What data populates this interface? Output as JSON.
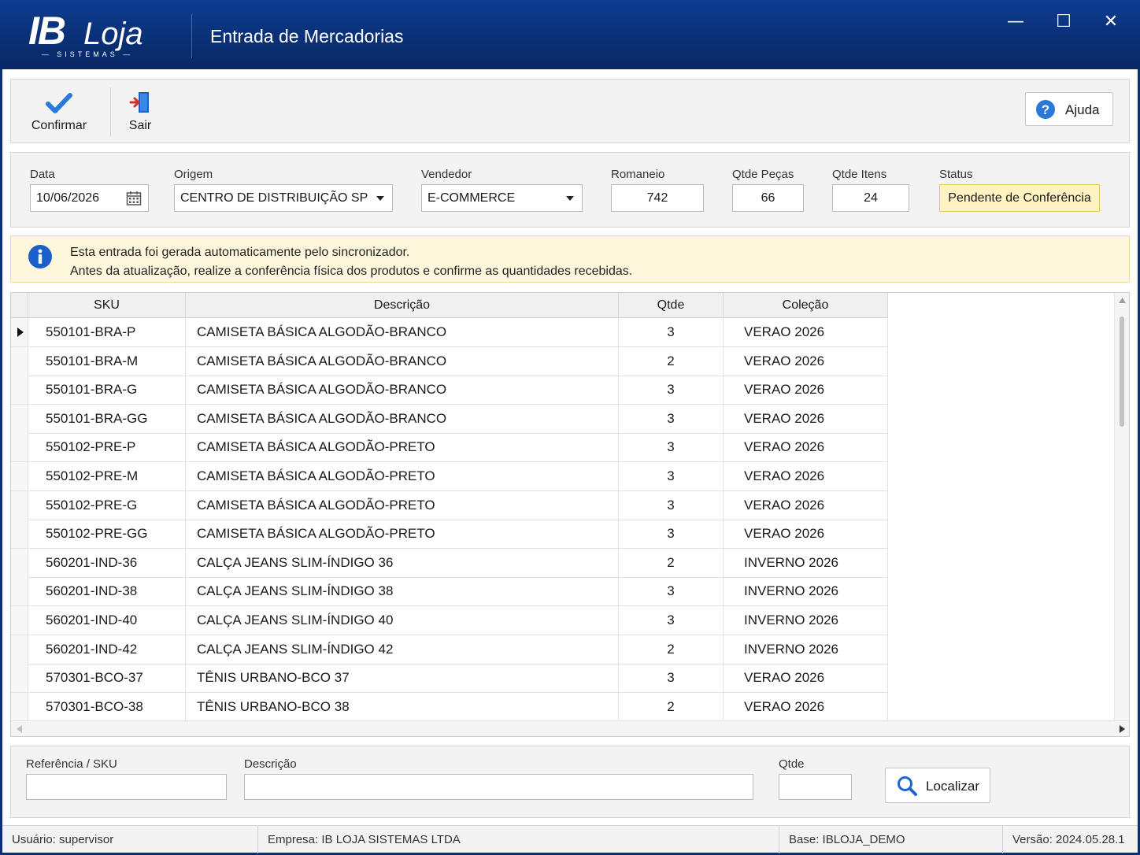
{
  "window": {
    "logo_main": "IB",
    "logo_secondary": "Loja",
    "logo_sub": "— SISTEMAS —",
    "title": "Entrada de Mercadorias",
    "minimize": "—",
    "maximize": "☐",
    "close": "✕"
  },
  "toolbar": {
    "confirm_label": "Confirmar",
    "exit_label": "Sair",
    "help_label": "Ajuda"
  },
  "form": {
    "data_label": "Data",
    "data_value": "10/06/2026",
    "origem_label": "Origem",
    "origem_value": "CENTRO DE DISTRIBUIÇÃO SP",
    "vendedor_label": "Vendedor",
    "vendedor_value": "E-COMMERCE",
    "romaneio_label": "Romaneio",
    "romaneio_value": "742",
    "qtde_pecas_label": "Qtde Peças",
    "qtde_pecas_value": "66",
    "qtde_itens_label": "Qtde Itens",
    "qtde_itens_value": "24",
    "status_label": "Status",
    "status_value": "Pendente de Conferência"
  },
  "info": {
    "line1": "Esta entrada foi gerada automaticamente pelo sincronizador.",
    "line2": "Antes da atualização, realize a conferência física dos produtos e confirme as quantidades recebidas."
  },
  "grid": {
    "headers": [
      "SKU",
      "Descrição",
      "Qtde",
      "Coleção"
    ],
    "rows": [
      [
        "550101-BRA-P",
        "CAMISETA BÁSICA ALGODÃO-BRANCO",
        "3",
        "VERAO 2026"
      ],
      [
        "550101-BRA-M",
        "CAMISETA BÁSICA ALGODÃO-BRANCO",
        "2",
        "VERAO 2026"
      ],
      [
        "550101-BRA-G",
        "CAMISETA BÁSICA ALGODÃO-BRANCO",
        "3",
        "VERAO 2026"
      ],
      [
        "550101-BRA-GG",
        "CAMISETA BÁSICA ALGODÃO-BRANCO",
        "3",
        "VERAO 2026"
      ],
      [
        "550102-PRE-P",
        "CAMISETA BÁSICA ALGODÃO-PRETO",
        "3",
        "VERAO 2026"
      ],
      [
        "550102-PRE-M",
        "CAMISETA BÁSICA ALGODÃO-PRETO",
        "3",
        "VERAO 2026"
      ],
      [
        "550102-PRE-G",
        "CAMISETA BÁSICA ALGODÃO-PRETO",
        "3",
        "VERAO 2026"
      ],
      [
        "550102-PRE-GG",
        "CAMISETA BÁSICA ALGODÃO-PRETO",
        "3",
        "VERAO 2026"
      ],
      [
        "560201-IND-36",
        "CALÇA JEANS SLIM-ÍNDIGO 36",
        "2",
        "INVERNO 2026"
      ],
      [
        "560201-IND-38",
        "CALÇA JEANS SLIM-ÍNDIGO 38",
        "3",
        "INVERNO 2026"
      ],
      [
        "560201-IND-40",
        "CALÇA JEANS SLIM-ÍNDIGO 40",
        "3",
        "INVERNO 2026"
      ],
      [
        "560201-IND-42",
        "CALÇA JEANS SLIM-ÍNDIGO 42",
        "2",
        "INVERNO 2026"
      ],
      [
        "570301-BCO-37",
        "TÊNIS URBANO-BCO 37",
        "3",
        "VERAO 2026"
      ],
      [
        "570301-BCO-38",
        "TÊNIS URBANO-BCO 38",
        "2",
        "VERAO 2026"
      ]
    ]
  },
  "search": {
    "ref_label": "Referência / SKU",
    "ref_value": "",
    "desc_label": "Descrição",
    "desc_value": "",
    "qtde_label": "Qtde",
    "qtde_value": "",
    "find_label": "Localizar"
  },
  "statusbar": {
    "user": "Usuário: supervisor",
    "company": "Empresa: IB LOJA SISTEMAS LTDA",
    "base": "Base: IBLOJA_DEMO",
    "version": "Versão: 2024.05.28.1"
  },
  "colors": {
    "titlebar": "#0a2f74",
    "accent_blue": "#1a6fd0",
    "status_bg": "#fff3c2",
    "info_bg": "#fff7dc"
  }
}
